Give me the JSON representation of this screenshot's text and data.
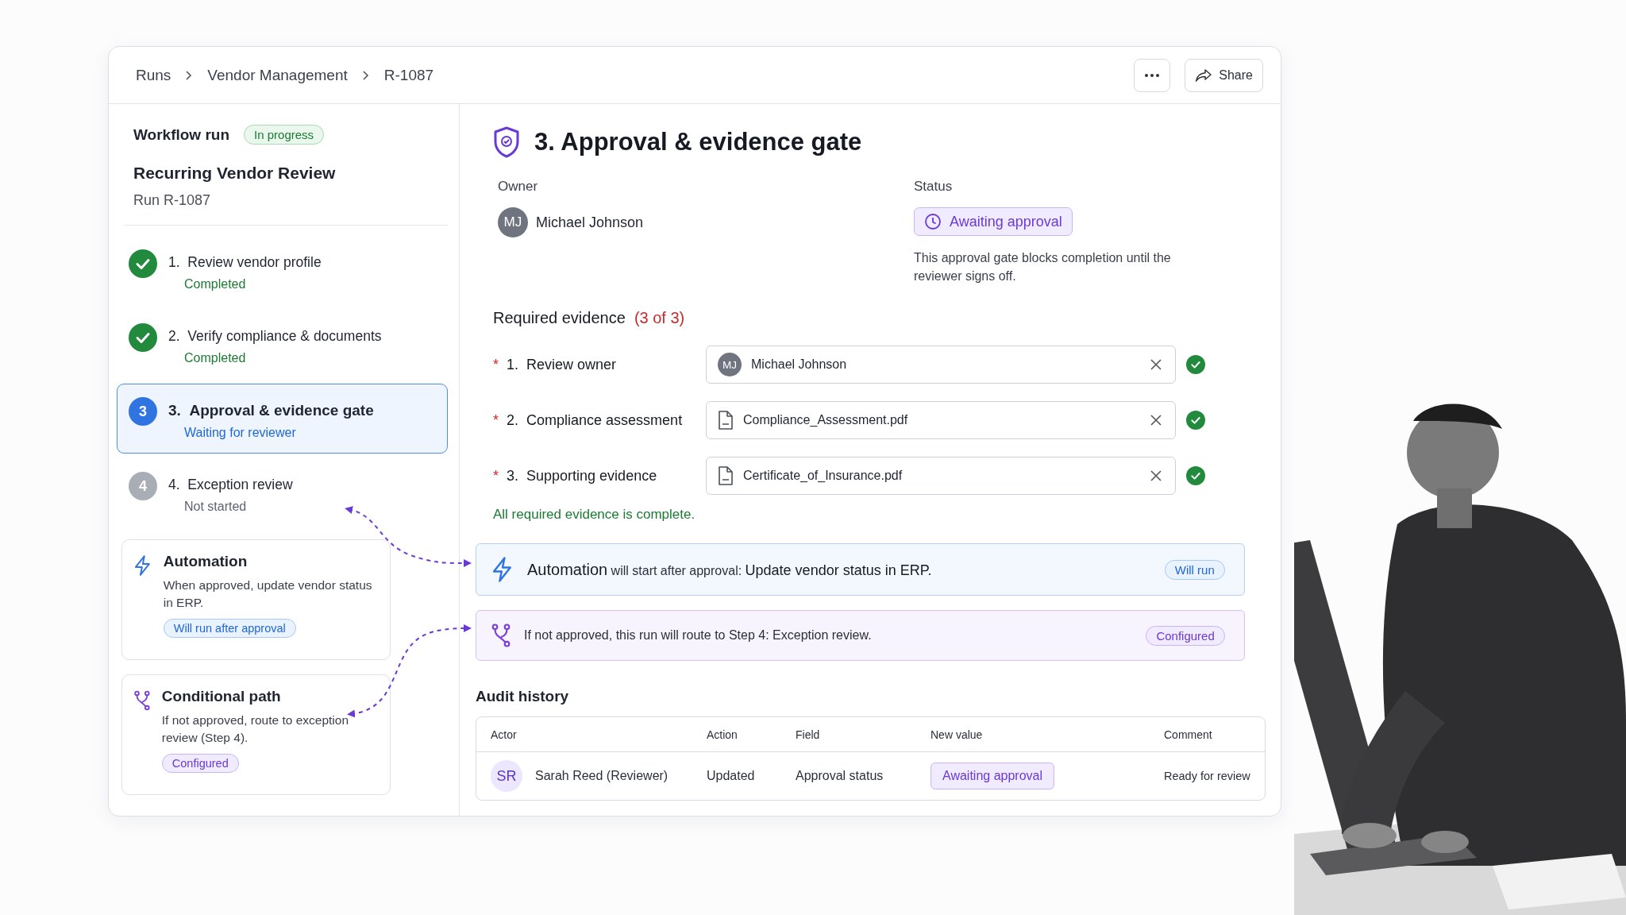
{
  "breadcrumb": [
    "Runs",
    "Vendor Management",
    "R-1087"
  ],
  "actions": {
    "share": "Share"
  },
  "run": {
    "label": "Workflow run",
    "badge": "In progress",
    "name": "Recurring Vendor Review",
    "run_id": "Run R-1087"
  },
  "steps": [
    {
      "number": "1.",
      "title": "Review vendor profile",
      "status": "Completed",
      "kind": "completed",
      "selected": false
    },
    {
      "number": "2.",
      "title": "Verify compliance & documents",
      "status": "Completed",
      "kind": "completed",
      "selected": false
    },
    {
      "number": "3.",
      "title": "Approval & evidence gate",
      "status": "Waiting for reviewer",
      "kind": "active",
      "badge": "3",
      "selected": true
    },
    {
      "number": "4.",
      "title": "Exception review",
      "status": "Not started",
      "kind": "pending",
      "badge": "4",
      "selected": false
    }
  ],
  "side_cards": [
    {
      "kind": "automation",
      "title": "Automation",
      "text": "When approved, update vendor status in ERP.",
      "tag": "Will run after approval"
    },
    {
      "kind": "conditional",
      "title": "Conditional path",
      "text": "If not approved, route to exception review (Step 4).",
      "tag": "Configured"
    }
  ],
  "detail": {
    "title": "3. Approval & evidence gate",
    "owner_label": "Owner",
    "owner": {
      "initials": "MJ",
      "name": "Michael Johnson"
    },
    "status_label": "Status",
    "status": "Awaiting approval",
    "status_note": "This approval gate blocks completion until the reviewer signs off."
  },
  "evidence": {
    "heading": "Required evidence",
    "count": "(3 of 3)",
    "items": [
      {
        "marker": "*",
        "number": "1.",
        "label": "Review owner",
        "kind": "person",
        "initials": "MJ",
        "value": "Michael Johnson",
        "complete": true
      },
      {
        "marker": "*",
        "number": "2.",
        "label": "Compliance assessment",
        "kind": "file",
        "value": "Compliance_Assessment.pdf",
        "complete": true
      },
      {
        "marker": "*",
        "number": "3.",
        "label": "Supporting evidence",
        "kind": "file",
        "value": "Certificate_of_Insurance.pdf",
        "complete": true
      }
    ],
    "summary": "All required evidence is complete."
  },
  "notices": [
    {
      "kind": "automation",
      "text": "**Automation** will start after approval:  **Update vendor status in ERP.**",
      "tag": "Will run"
    },
    {
      "kind": "route",
      "text": "If not approved, this run will route to Step 4:  Exception review.",
      "tag": "Configured"
    }
  ],
  "audit": {
    "heading": "Audit history",
    "columns": [
      "Actor",
      "Action",
      "Field",
      "New value",
      "Comment"
    ],
    "rows": [
      {
        "initials": "SR",
        "actor": "Sarah Reed (Reviewer)",
        "action": "Updated",
        "field": "Approval status",
        "new_value": "Awaiting approval",
        "comment": "Ready for review"
      }
    ]
  }
}
